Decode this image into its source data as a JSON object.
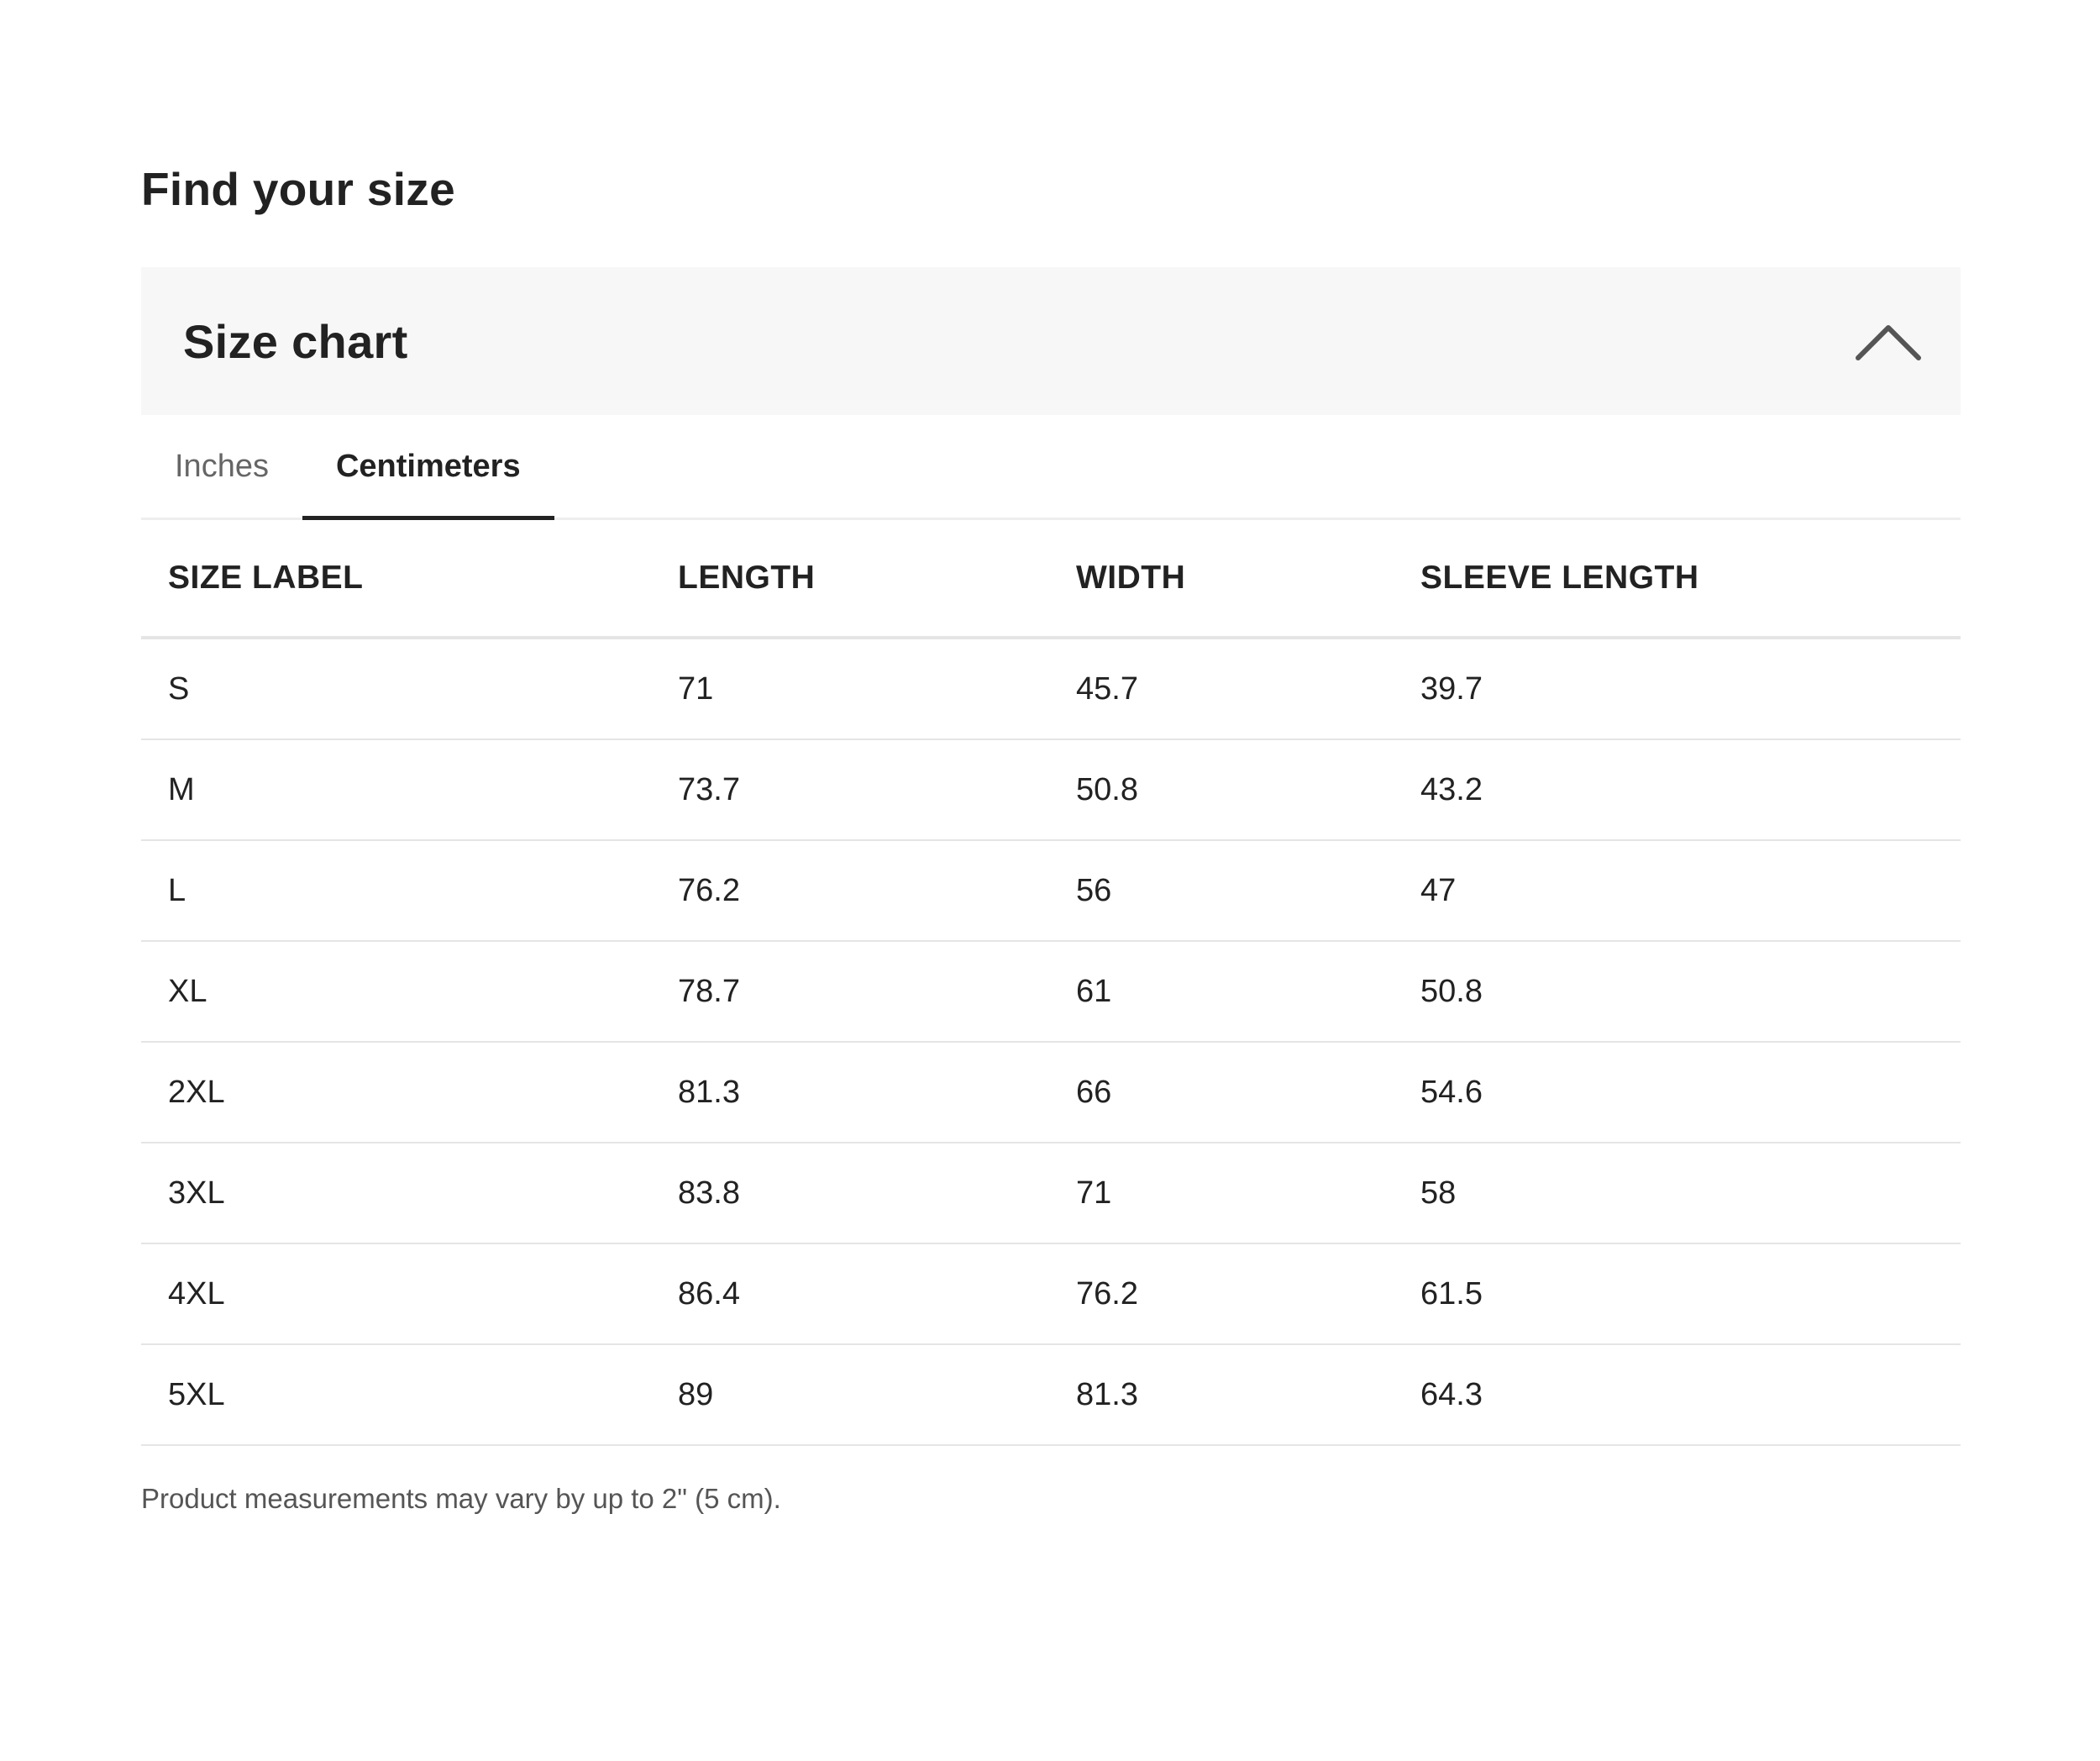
{
  "page": {
    "title": "Find your size"
  },
  "accordion": {
    "title": "Size chart",
    "icon": "chevron-up-icon",
    "expanded": true
  },
  "tabs": [
    {
      "label": "Inches",
      "active": false
    },
    {
      "label": "Centimeters",
      "active": true
    }
  ],
  "table": {
    "headers": [
      "SIZE LABEL",
      "LENGTH",
      "WIDTH",
      "SLEEVE LENGTH"
    ],
    "rows": [
      [
        "S",
        "71",
        "45.7",
        "39.7"
      ],
      [
        "M",
        "73.7",
        "50.8",
        "43.2"
      ],
      [
        "L",
        "76.2",
        "56",
        "47"
      ],
      [
        "XL",
        "78.7",
        "61",
        "50.8"
      ],
      [
        "2XL",
        "81.3",
        "66",
        "54.6"
      ],
      [
        "3XL",
        "83.8",
        "71",
        "58"
      ],
      [
        "4XL",
        "86.4",
        "76.2",
        "61.5"
      ],
      [
        "5XL",
        "89",
        "81.3",
        "64.3"
      ]
    ]
  },
  "footnote": "Product measurements may vary by up to 2\" (5 cm).",
  "colors": {
    "header_bg": "#f7f7f7",
    "text": "#222222",
    "muted": "#666666",
    "divider": "#e5e5e5"
  }
}
